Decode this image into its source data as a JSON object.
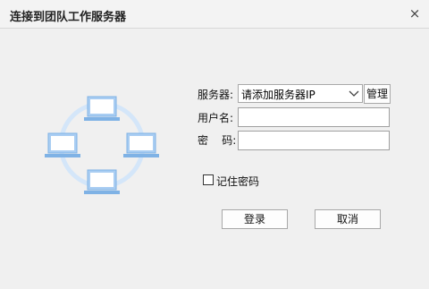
{
  "window": {
    "title": "连接到团队工作服务器",
    "close_icon": "×"
  },
  "form": {
    "server_label": "服务器:",
    "server_value": "请添加服务器IP",
    "manage_label": "管理",
    "username_label": "用户名:",
    "username_value": "",
    "password_label": "密    码:",
    "password_value": "",
    "remember_label": "记住密码",
    "remember_checked": false
  },
  "buttons": {
    "login": "登录",
    "cancel": "取消"
  },
  "colors": {
    "illustration": "#a9cdf2",
    "illustration_dark": "#6ea7e0",
    "ring": "#d4e6f9"
  }
}
